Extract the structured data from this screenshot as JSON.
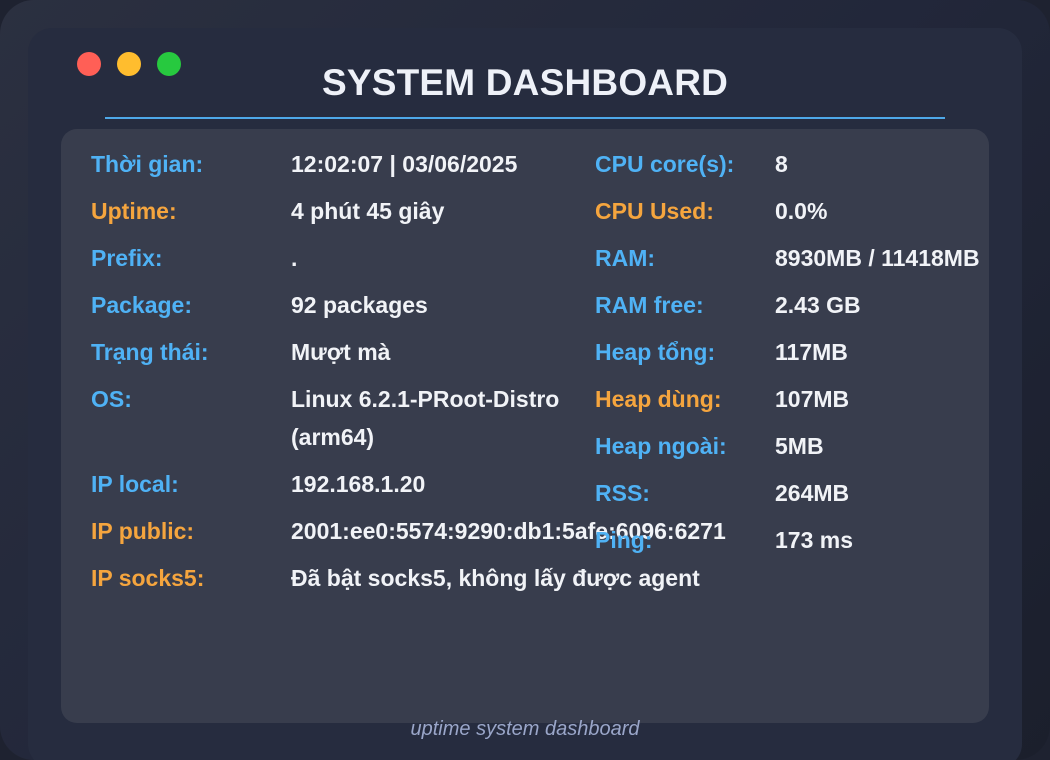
{
  "window": {
    "title": "SYSTEM DASHBOARD",
    "footer": "uptime system dashboard",
    "controls": [
      "close",
      "minimize",
      "maximize"
    ]
  },
  "colors": {
    "label_blue": "#4fb2f5",
    "label_orange": "#f5a53e",
    "value": "#f1f3f7",
    "accent_line": "#4ea8e8",
    "panel_bg": "#383d4d"
  },
  "left": [
    {
      "label": "Thời gian:",
      "value": "12:02:07 | 03/06/2025",
      "color": "blue"
    },
    {
      "label": "Uptime:",
      "value": "4 phút 45 giây",
      "color": "orange"
    },
    {
      "label": "Prefix:",
      "value": ".",
      "color": "blue"
    },
    {
      "label": "Package:",
      "value": "92 packages",
      "color": "blue"
    },
    {
      "label": "Trạng thái:",
      "value": "Mượt mà",
      "color": "blue"
    },
    {
      "label": "OS:",
      "value": "Linux 6.2.1-PRoot-Distro (arm64)",
      "color": "blue"
    },
    {
      "label": "IP local:",
      "value": "192.168.1.20",
      "color": "blue"
    },
    {
      "label": "IP public:",
      "value": "2001:ee0:5574:9290:db1:5afe:6096:6271",
      "color": "orange"
    },
    {
      "label": "IP socks5:",
      "value": "Đã bật socks5, không lấy được agent",
      "color": "orange"
    }
  ],
  "right": [
    {
      "label": "CPU core(s):",
      "value": "8",
      "color": "blue"
    },
    {
      "label": "CPU Used:",
      "value": "0.0%",
      "color": "orange"
    },
    {
      "label": "RAM:",
      "value": "8930MB / 11418MB",
      "color": "blue"
    },
    {
      "label": "RAM free:",
      "value": "2.43 GB",
      "color": "blue"
    },
    {
      "label": "Heap tổng:",
      "value": "117MB",
      "color": "blue"
    },
    {
      "label": "Heap dùng:",
      "value": "107MB",
      "color": "orange"
    },
    {
      "label": "Heap ngoài:",
      "value": "5MB",
      "color": "blue"
    },
    {
      "label": "RSS:",
      "value": "264MB",
      "color": "blue"
    },
    {
      "label": "Ping:",
      "value": "173 ms",
      "color": "blue"
    }
  ]
}
